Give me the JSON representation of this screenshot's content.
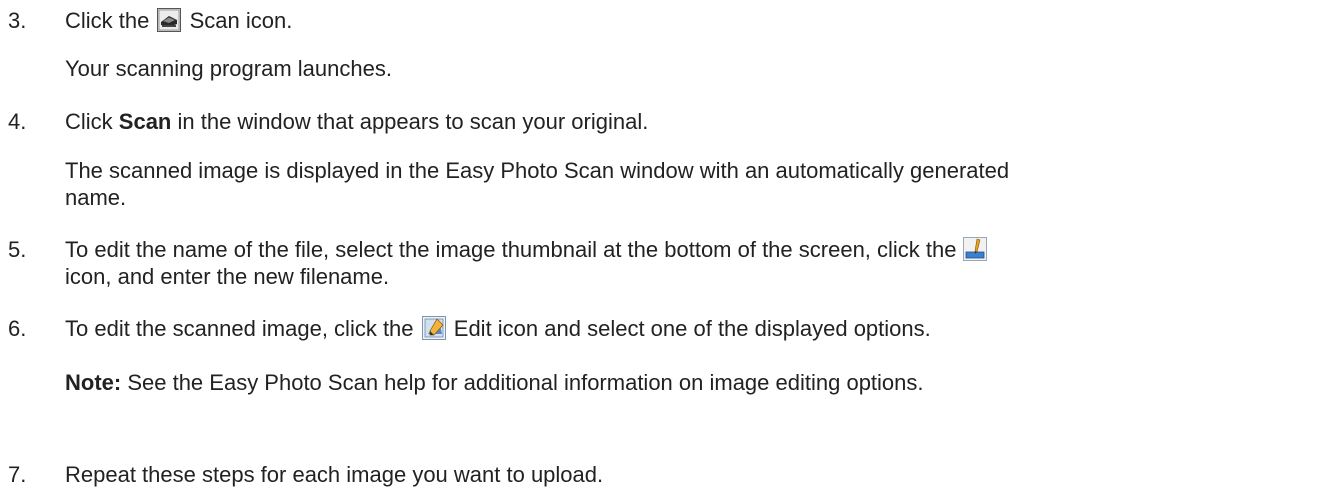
{
  "steps": [
    {
      "number": "3.",
      "before_icon": "Click the ",
      "icon": "scan-icon",
      "after_icon": " Scan icon.",
      "result": "Your scanning program launches."
    },
    {
      "number": "4.",
      "pre": "Click ",
      "bold": "Scan",
      "post": " in the window that appears to scan your original.",
      "result_line1": "The scanned image is displayed in the Easy Photo Scan window with an automatically generated",
      "result_line2": "name."
    },
    {
      "number": "5.",
      "line1": "To edit the name of the file, select the image thumbnail at the bottom of the screen, click the",
      "icon": "rename-icon",
      "line2": "icon, and enter the new filename."
    },
    {
      "number": "6.",
      "before_icon": "To edit the scanned image, click the ",
      "icon": "edit-icon",
      "after_icon": " Edit icon and select one of the displayed options."
    },
    {
      "number": "7.",
      "text": "Repeat these steps for each image you want to upload."
    }
  ],
  "note": {
    "label": "Note:",
    "text": " See the Easy Photo Scan help for additional information on image editing options."
  }
}
